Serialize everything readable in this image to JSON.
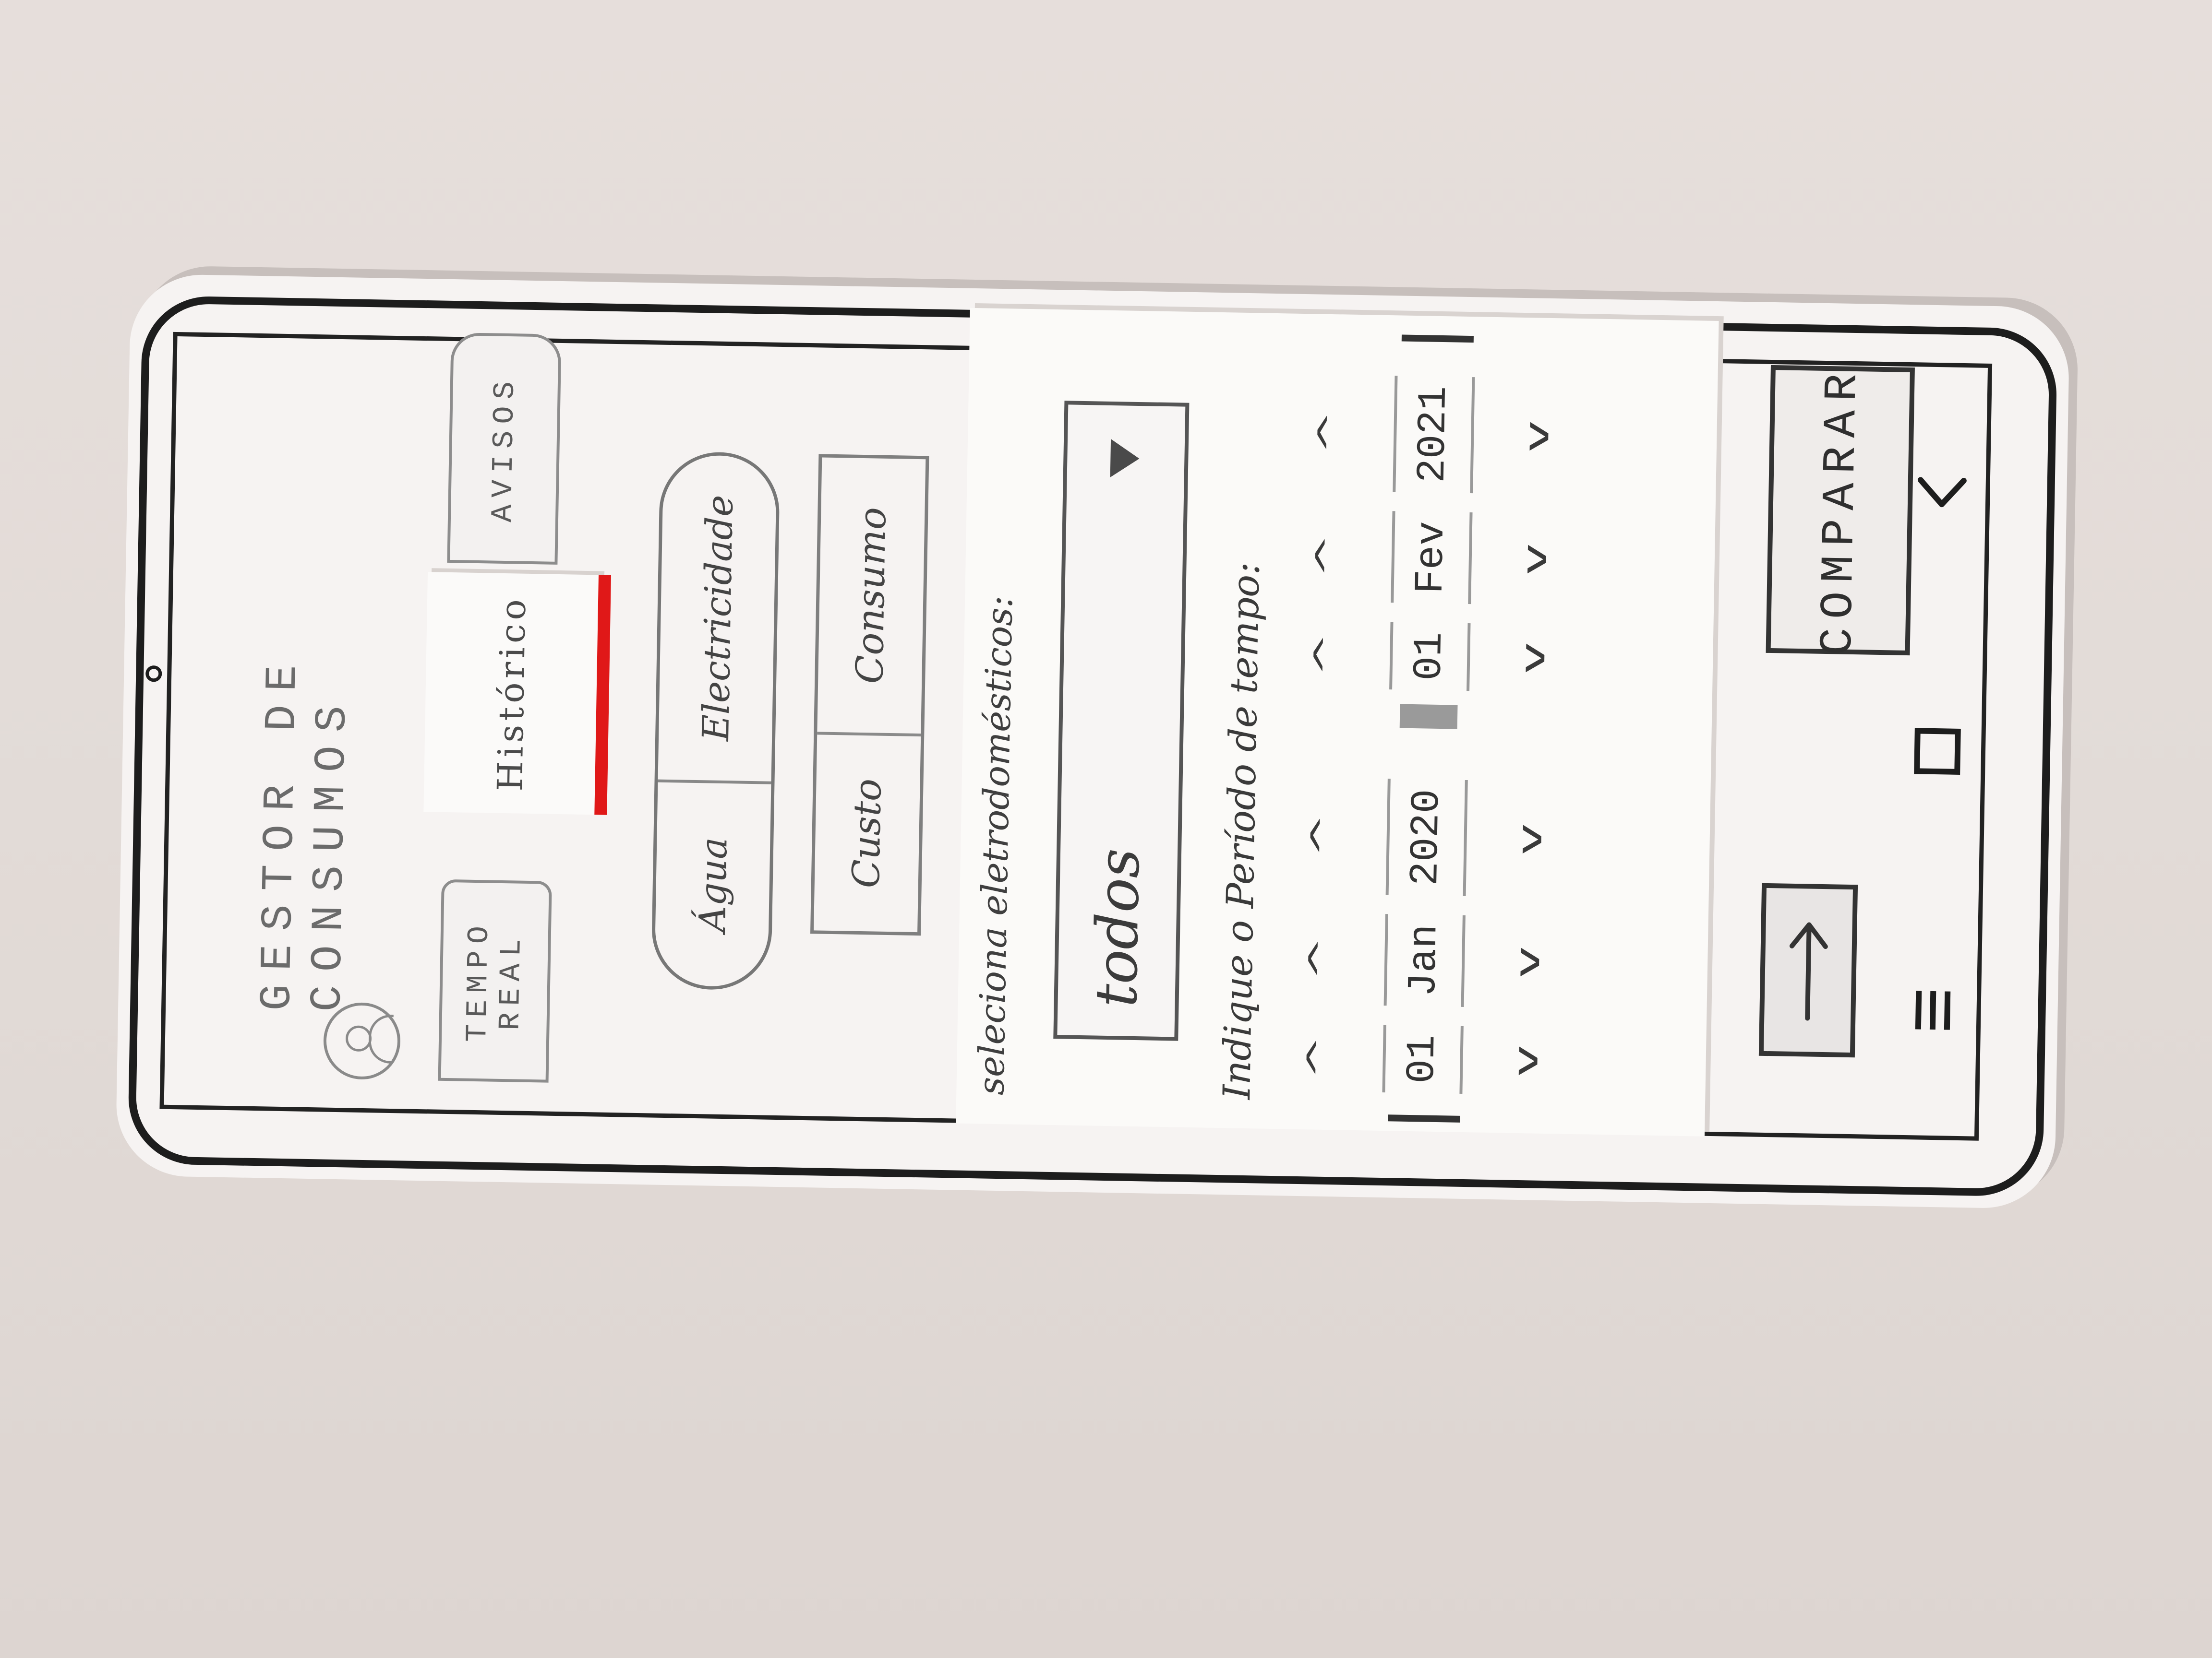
{
  "header": {
    "title": "GESTOR DE CONSUMOS"
  },
  "tabs": [
    {
      "id": "realtime",
      "label": "TEMPO REAL"
    },
    {
      "id": "historico",
      "label": "Histórico",
      "active": true
    },
    {
      "id": "avisos",
      "label": "AVISOS"
    }
  ],
  "resource_toggle": {
    "water": "Água",
    "electricity": "Electricidade"
  },
  "metric_toggle": {
    "cost": "Custo",
    "consumption": "Consumo"
  },
  "filters": {
    "meters_prompt": "seleciona eletrodomésticos:",
    "meter_select_value": "todos",
    "period_prompt": "Indique o Período de tempo:",
    "start_date": {
      "day": "01",
      "month": "Jan",
      "year": "2020"
    },
    "end_date": {
      "day": "01",
      "month": "Fev",
      "year": "2021"
    }
  },
  "actions": {
    "compare_label": "COMPARAR"
  },
  "colors": {
    "active_tab_indicator": "#e01818",
    "paper": "#f6f3f2",
    "ink": "#222222"
  },
  "icons": {
    "profile": "avatar-icon",
    "export": "arrow-down-icon",
    "dropdown": "triangle-down-icon",
    "nav_back": "chevron-left-icon",
    "nav_home": "square-icon",
    "nav_menu": "menu-icon"
  }
}
